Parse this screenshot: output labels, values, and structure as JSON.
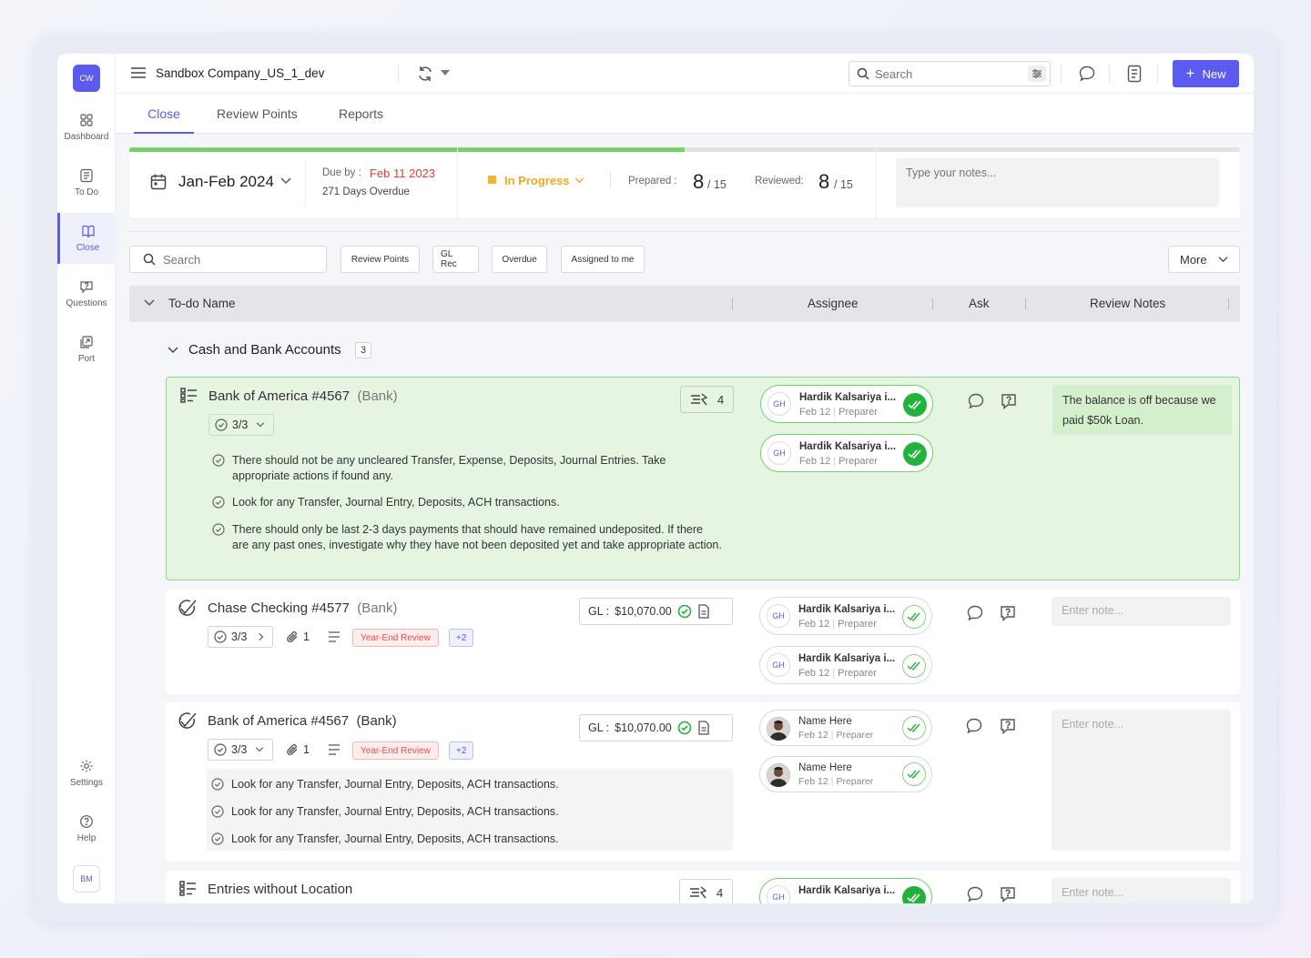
{
  "app": {
    "logo_text": "CW",
    "user_initials": "BM"
  },
  "sidebar": {
    "items": [
      {
        "label": "Dashboard",
        "icon": "grid-icon"
      },
      {
        "label": "To Do",
        "icon": "checklist-icon"
      },
      {
        "label": "Close",
        "icon": "book-icon",
        "active": true
      },
      {
        "label": "Questions",
        "icon": "question-icon"
      },
      {
        "label": "Port",
        "icon": "port-icon"
      }
    ],
    "bottom": [
      {
        "label": "Settings",
        "icon": "gear-icon"
      },
      {
        "label": "Help",
        "icon": "help-icon"
      }
    ]
  },
  "topbar": {
    "company": "Sandbox Company_US_1_dev",
    "search_placeholder": "Search",
    "new_label": "New"
  },
  "tabs": [
    "Close",
    "Review Points",
    "Reports"
  ],
  "summary": {
    "period": "Jan-Feb 2024",
    "due_label": "Due by :",
    "due_date": "Feb 11 2023",
    "overdue": "271 Days Overdue",
    "status": "In Progress",
    "prepared_label": "Prepared :",
    "prepared_value": "8",
    "prepared_total": "/ 15",
    "reviewed_label": "Reviewed:",
    "reviewed_value": "8",
    "reviewed_total": "/ 15",
    "notes_placeholder": "Type your notes...",
    "progress": 0.5
  },
  "filters": {
    "search_placeholder": "Search",
    "chips": [
      "Review Points",
      "GL Rec",
      "Overdue",
      "Assigned to me"
    ],
    "more_label": "More"
  },
  "table": {
    "columns": [
      "To-do Name",
      "Assignee",
      "Ask",
      "Review Notes"
    ]
  },
  "group": {
    "name": "Cash and Bank Accounts",
    "count": "3"
  },
  "cards": [
    {
      "title": "Bank of America #4567",
      "category": "(Bank)",
      "badge_count": "4",
      "progress": "3/3",
      "checks": [
        "There should not be any uncleared Transfer, Expense, Deposits, Journal Entries. Take appropriate actions if found any.",
        "Look for any Transfer, Journal Entry, Deposits, ACH transactions.",
        "There should only be last 2-3 days payments that should have remained undeposited. If there are any past ones, investigate why they have not been deposited yet and take appropriate action."
      ],
      "assignees": [
        {
          "initials": "GH",
          "name": "Hardik Kalsariya i...",
          "date": "Feb 12",
          "role": "Preparer"
        },
        {
          "initials": "GH",
          "name": "Hardik Kalsariya i...",
          "date": "Feb 12",
          "role": "Preparer"
        }
      ],
      "note": "The balance is off because we paid $50k Loan."
    },
    {
      "title": "Chase Checking #4577",
      "category": "(Bank)",
      "gl_label": "GL :",
      "gl_value": "$10,070.00",
      "progress": "3/3",
      "attachments": "1",
      "tag": "Year-End Review",
      "more_tags": "+2",
      "assignees": [
        {
          "initials": "GH",
          "name": "Hardik Kalsariya i...",
          "date": "Feb 12",
          "role": "Preparer"
        },
        {
          "initials": "GH",
          "name": "Hardik Kalsariya i...",
          "date": "Feb 12",
          "role": "Preparer"
        }
      ],
      "note_placeholder": "Enter note..."
    },
    {
      "title": "Bank of America #4567",
      "category": "(Bank)",
      "gl_label": "GL :",
      "gl_value": "$10,070.00",
      "progress": "3/3",
      "attachments": "1",
      "tag": "Year-End Review",
      "more_tags": "+2",
      "checks": [
        "Look for any Transfer, Journal Entry, Deposits, ACH transactions.",
        "Look for any Transfer, Journal Entry, Deposits, ACH transactions.",
        "Look for any Transfer, Journal Entry, Deposits, ACH transactions."
      ],
      "assignees": [
        {
          "name": "Name Here",
          "date": "Feb 12",
          "role": "Preparer"
        },
        {
          "name": "Name Here",
          "date": "Feb 12",
          "role": "Preparer"
        }
      ],
      "note_placeholder": "Enter note..."
    },
    {
      "title": "Entries without Location",
      "badge_count": "4",
      "assignees": [
        {
          "initials": "GH",
          "name": "Hardik Kalsariya i..."
        }
      ],
      "note_placeholder": "Enter note..."
    }
  ]
}
